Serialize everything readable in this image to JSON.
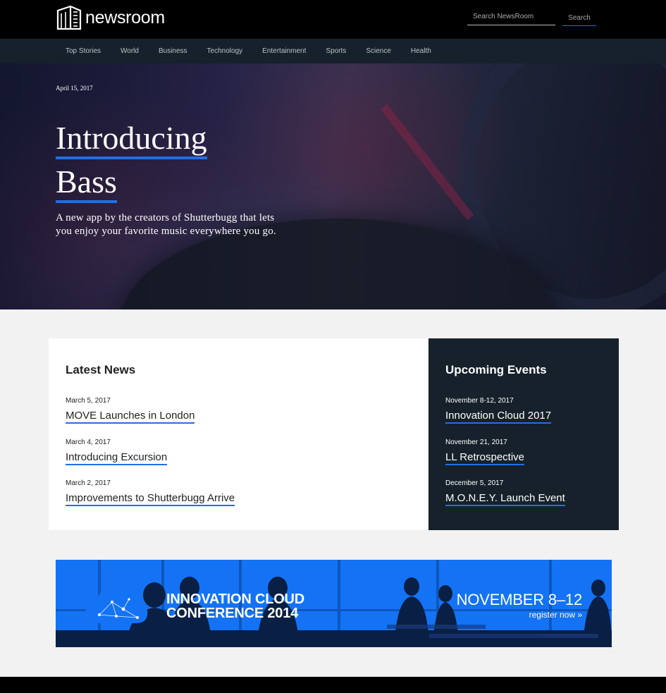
{
  "header": {
    "logo_text": "newsroom",
    "search_placeholder": "Search NewsRoom",
    "search_button": "Search"
  },
  "nav": {
    "items": [
      "Top Stories",
      "World",
      "Business",
      "Technology",
      "Entertainment",
      "Sports",
      "Science",
      "Health"
    ]
  },
  "hero": {
    "date": "April 15, 2017",
    "title_line1": "Introducing",
    "title_line2": "Bass",
    "description": "A new app by the creators of Shutterbugg that lets you enjoy your favorite music everywhere you go."
  },
  "latest_news": {
    "title": "Latest News",
    "items": [
      {
        "date": "March 5, 2017",
        "title": "MOVE Launches in London"
      },
      {
        "date": "March 4, 2017",
        "title": "Introducing Excursion"
      },
      {
        "date": "March 2, 2017",
        "title": "Improvements to Shutterbugg Arrive"
      }
    ]
  },
  "upcoming_events": {
    "title": "Upcoming Events",
    "items": [
      {
        "date": "November 8-12, 2017",
        "title": "Innovation Cloud 2017"
      },
      {
        "date": "November 21, 2017",
        "title": "LL Retrospective"
      },
      {
        "date": "December 5, 2017",
        "title": "M.O.N.E.Y. Launch Event"
      }
    ]
  },
  "banner": {
    "title_line1": "INNOVATION CLOUD",
    "title_line2": "CONFERENCE 2014",
    "date": "NOVEMBER 8–12",
    "link": "register now »"
  },
  "colors": {
    "accent": "#1f6fe8",
    "topbar": "#000000",
    "navbar": "#16212b",
    "banner": "#1473f5"
  }
}
